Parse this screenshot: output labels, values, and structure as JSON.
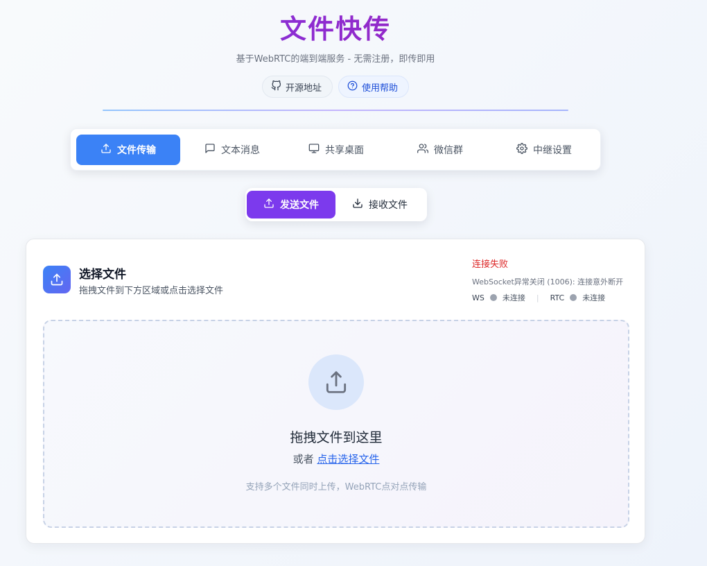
{
  "header": {
    "title": "文件快传",
    "subtitle": "基于WebRTC的端到端服务 - 无需注册，即传即用",
    "links": [
      {
        "label": "开源地址",
        "icon": "github-icon"
      },
      {
        "label": "使用帮助",
        "icon": "help-circle-icon"
      }
    ]
  },
  "tabs": [
    {
      "label": "文件传输",
      "icon": "upload-icon",
      "active": true
    },
    {
      "label": "文本消息",
      "icon": "message-icon",
      "active": false
    },
    {
      "label": "共享桌面",
      "icon": "monitor-icon",
      "active": false
    },
    {
      "label": "微信群",
      "icon": "users-icon",
      "active": false
    },
    {
      "label": "中继设置",
      "icon": "gear-icon",
      "active": false
    }
  ],
  "mode_tabs": [
    {
      "label": "发送文件",
      "icon": "upload-icon",
      "active": true
    },
    {
      "label": "接收文件",
      "icon": "download-icon",
      "active": false
    }
  ],
  "card": {
    "title": "选择文件",
    "description": "拖拽文件到下方区域或点击选择文件"
  },
  "status": {
    "title": "连接失败",
    "message": "WebSocket异常关闭 (1006): 连接意外断开",
    "ws_label": "WS",
    "ws_state": "未连接",
    "separator": "|",
    "rtc_label": "RTC",
    "rtc_state": "未连接"
  },
  "dropzone": {
    "title": "拖拽文件到这里",
    "or_text": "或者",
    "select_link": "点击选择文件",
    "hint": "支持多个文件同时上传，WebRTC点对点传输"
  },
  "colors": {
    "primary_blue": "#3b82f6",
    "primary_purple": "#7c3aed",
    "error_red": "#dc2626",
    "link_blue": "#2563eb"
  }
}
